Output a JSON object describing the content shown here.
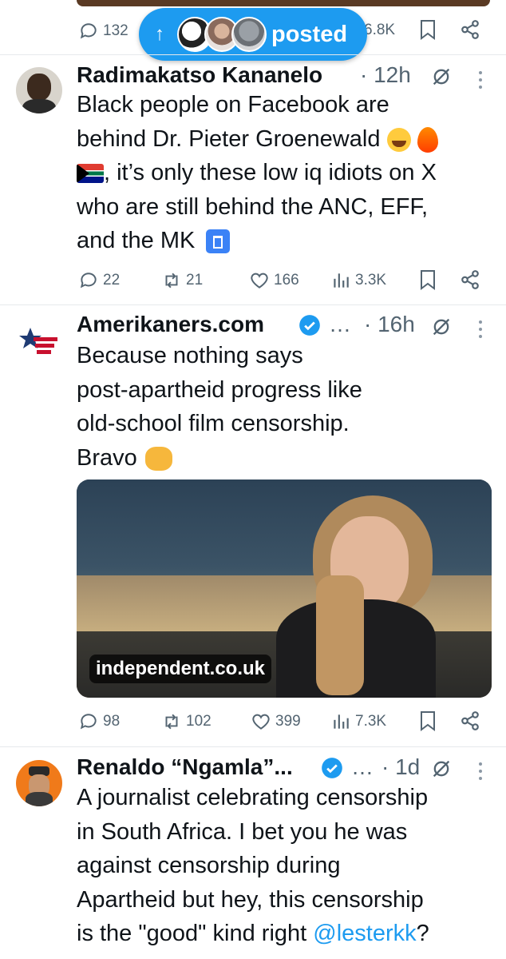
{
  "top_bar": {
    "reply_count": "132",
    "views_partial": "6.8K",
    "posted_pill": {
      "label": "posted",
      "arrow": "↑"
    }
  },
  "posts": [
    {
      "name": "Radimakatso Kananelo",
      "time": "12h",
      "lines": [
        "Black people on Facebook are",
        "behind Dr. Pieter Groenewald",
        ", it’s only these low iq idiots on X",
        "who are still behind the ANC, EFF,",
        "and the MK"
      ],
      "stats": {
        "replies": "22",
        "reposts": "21",
        "likes": "166",
        "views": "3.3K"
      }
    },
    {
      "name": "Amerikaners.com",
      "ellipsis": "…",
      "time": "16h",
      "lines": [
        "Because nothing says",
        "post-apartheid progress like",
        "old-school film censorship.",
        "Bravo"
      ],
      "card_domain": "independent.co.uk",
      "stats": {
        "replies": "98",
        "reposts": "102",
        "likes": "399",
        "views": "7.3K"
      }
    },
    {
      "name": "Renaldo “Ngamla”...",
      "ellipsis": "…",
      "time": "1d",
      "lines": [
        "A journalist celebrating censorship",
        "in South Africa. I bet you he was",
        "against censorship during",
        "Apartheid but hey, this censorship",
        "is the \"good\" kind right "
      ],
      "mention": "@lesterkk",
      "tail": "?"
    }
  ],
  "colors": {
    "accent": "#1d9bf0",
    "muted": "#536471",
    "text": "#0f1419",
    "divider": "#e6e9ec"
  }
}
